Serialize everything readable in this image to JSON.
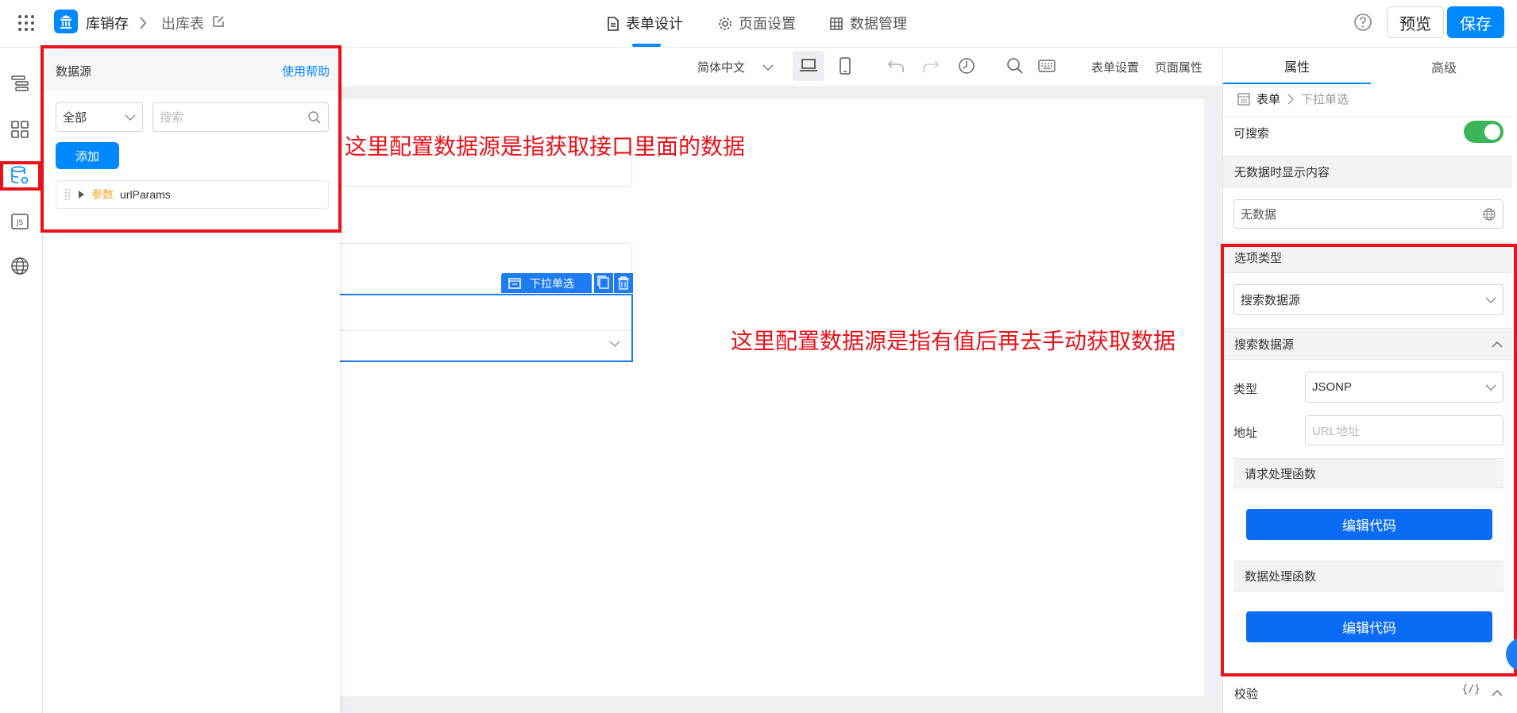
{
  "header": {
    "app_name": "库销存",
    "page_name": "出库表",
    "tabs": [
      {
        "label": "表单设计",
        "active": true
      },
      {
        "label": "页面设置",
        "active": false
      },
      {
        "label": "数据管理",
        "active": false
      }
    ],
    "preview_label": "预览",
    "save_label": "保存"
  },
  "toolbar": {
    "language": "简体中文",
    "form_settings": "表单设置",
    "page_properties": "页面属性"
  },
  "data_source_panel": {
    "title": "数据源",
    "help_link": "使用帮助",
    "filter_select": "全部",
    "search_placeholder": "搜索",
    "add_button": "添加",
    "tree_item": {
      "tag": "参数",
      "name": "urlParams"
    }
  },
  "canvas": {
    "selected_component_label": "下拉单选"
  },
  "right_panel": {
    "tabs": [
      {
        "label": "属性",
        "active": true
      },
      {
        "label": "高级",
        "active": false
      }
    ],
    "breadcrumb": {
      "root": "表单",
      "current": "下拉单选"
    },
    "searchable_label": "可搜索",
    "searchable_on": true,
    "no_data_section": "无数据时显示内容",
    "no_data_value": "无数据",
    "option_type_section": "选项类型",
    "option_type_value": "搜索数据源",
    "search_source_section": "搜索数据源",
    "type_label": "类型",
    "type_value": "JSONP",
    "address_label": "地址",
    "address_placeholder": "URL地址",
    "request_fn_section": "请求处理函数",
    "edit_code_1": "编辑代码",
    "data_fn_section": "数据处理函数",
    "edit_code_2": "编辑代码",
    "validation_section": "校验",
    "validation_icon_text": "{/}"
  },
  "annotations": {
    "left": "这里配置数据源是指获取接口里面的数据",
    "right": "这里配置数据源是指有值后再去手动获取数据"
  },
  "colors": {
    "accent": "#0089ff",
    "annotation_red": "#e8121a",
    "toggle_green": "#3cb55a",
    "param_tag": "#f5a623"
  }
}
